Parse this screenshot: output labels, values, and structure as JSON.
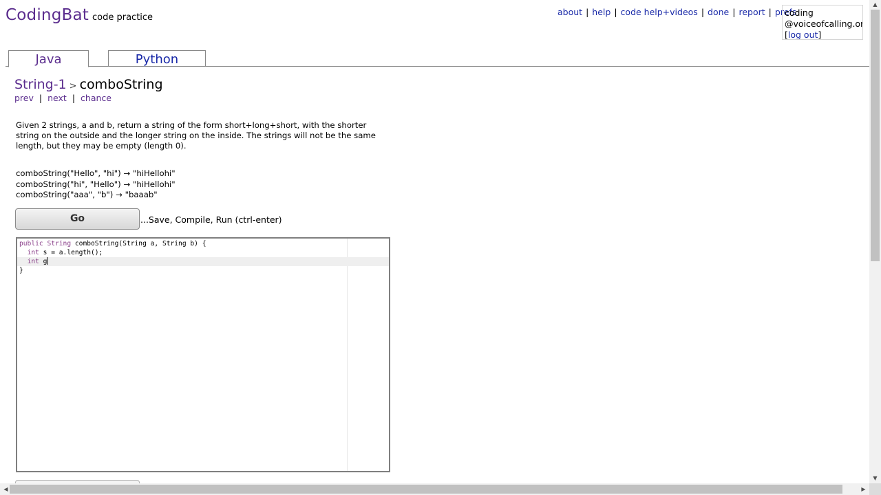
{
  "header": {
    "logo_title": "CodingBat",
    "logo_subtitle": "code practice",
    "nav": [
      "about",
      "help",
      "code help+videos",
      "done",
      "report",
      "prefs"
    ]
  },
  "user": {
    "line1": "coding",
    "line2": "@voiceofcalling.org",
    "logout": "log out"
  },
  "tabs": [
    {
      "label": "Java",
      "active": true
    },
    {
      "label": "Python",
      "active": false
    }
  ],
  "breadcrumb": {
    "section": "String-1",
    "separator": ">",
    "problem": "comboString"
  },
  "subnav": [
    "prev",
    "next",
    "chance"
  ],
  "description": "Given 2 strings, a and b, return a string of the form short+long+short, with the shorter string on the outside and the longer string on the inside. The strings will not be the same length, but they may be empty (length 0).",
  "examples": [
    "comboString(\"Hello\", \"hi\") → \"hiHellohi\"",
    "comboString(\"hi\", \"Hello\") → \"hiHellohi\"",
    "comboString(\"aaa\", \"b\") → \"baaab\""
  ],
  "go_button": {
    "label": "Go",
    "hint": "...Save, Compile, Run (ctrl-enter)"
  },
  "editor": {
    "lines": [
      "public String comboString(String a, String b) {",
      "  int s = a.length();",
      "  int g",
      "}"
    ],
    "active_line": 3
  },
  "colors": {
    "brand_purple": "#5b2d8e",
    "link_blue": "#1a2aa8",
    "keyword": "#8a3f8a"
  }
}
